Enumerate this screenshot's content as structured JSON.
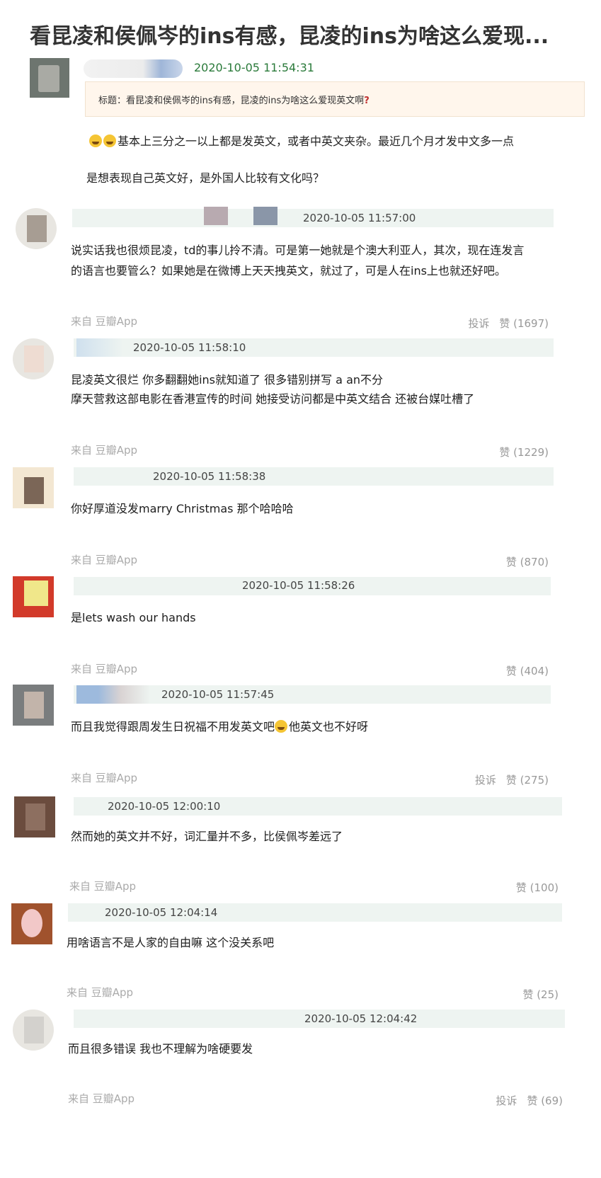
{
  "title": "看昆凌和侯佩岑的ins有感，昆凌的ins为啥这么爱现...",
  "op": {
    "time": "2020-10-05 11:54:31",
    "subject": "标题：看昆凌和侯佩岑的ins有感，昆凌的ins为啥这么爱现英文啊",
    "subject_mark": "?",
    "line1": "基本上三分之一以上都是发英文，或者中英文夹杂。最近几个月才发中文多一点",
    "line2": "是想表现自己英文好，是外国人比较有文化吗？"
  },
  "comments": [
    {
      "time": "2020-10-05 11:57:00",
      "lines": [
        "说实话我也很烦昆凌，td的事儿拎不清。可是第一她就是个澳大利亚人，其次，现在连发言",
        "的语言也要管么？如果她是在微博上天天拽英文，就过了，可是人在ins上也就还好吧。"
      ],
      "from": "来自 豆瓣App",
      "report": "投诉",
      "like": "赞 (1697)"
    },
    {
      "time": "2020-10-05 11:58:10",
      "lines": [
        "昆凌英文很烂 你多翻翻她ins就知道了 很多错别拼写 a an不分",
        "摩天营救这部电影在香港宣传的时间 她接受访问都是中英文结合 还被台媒吐槽了"
      ],
      "from": "来自 豆瓣App",
      "report": "",
      "like": "赞 (1229)"
    },
    {
      "time": "2020-10-05 11:58:38",
      "lines": [
        "你好厚道没发marry Christmas 那个哈哈哈"
      ],
      "from": "来自 豆瓣App",
      "report": "",
      "like": "赞 (870)"
    },
    {
      "time": "2020-10-05 11:58:26",
      "lines": [
        "是lets wash our hands"
      ],
      "from": "来自 豆瓣App",
      "report": "",
      "like": "赞 (404)"
    },
    {
      "time": "2020-10-05 11:57:45",
      "lines": [
        "而且我觉得跟周发生日祝福不用发英文吧",
        "他英文也不好呀"
      ],
      "from": "来自 豆瓣App",
      "report": "投诉",
      "like": "赞 (275)"
    },
    {
      "time": "2020-10-05 12:00:10",
      "lines": [
        "然而她的英文并不好，词汇量并不多，比侯佩岑差远了"
      ],
      "from": "来自 豆瓣App",
      "report": "",
      "like": "赞 (100)"
    },
    {
      "time": "2020-10-05 12:04:14",
      "lines": [
        "用啥语言不是人家的自由嘛 这个没关系吧"
      ],
      "from": "来自 豆瓣App",
      "report": "",
      "like": "赞 (25)"
    },
    {
      "time": "2020-10-05 12:04:42",
      "lines": [
        "而且很多错误 我也不理解为啥硬要发"
      ],
      "from": "来自 豆瓣App",
      "report": "投诉",
      "like": "赞 (69)"
    }
  ]
}
